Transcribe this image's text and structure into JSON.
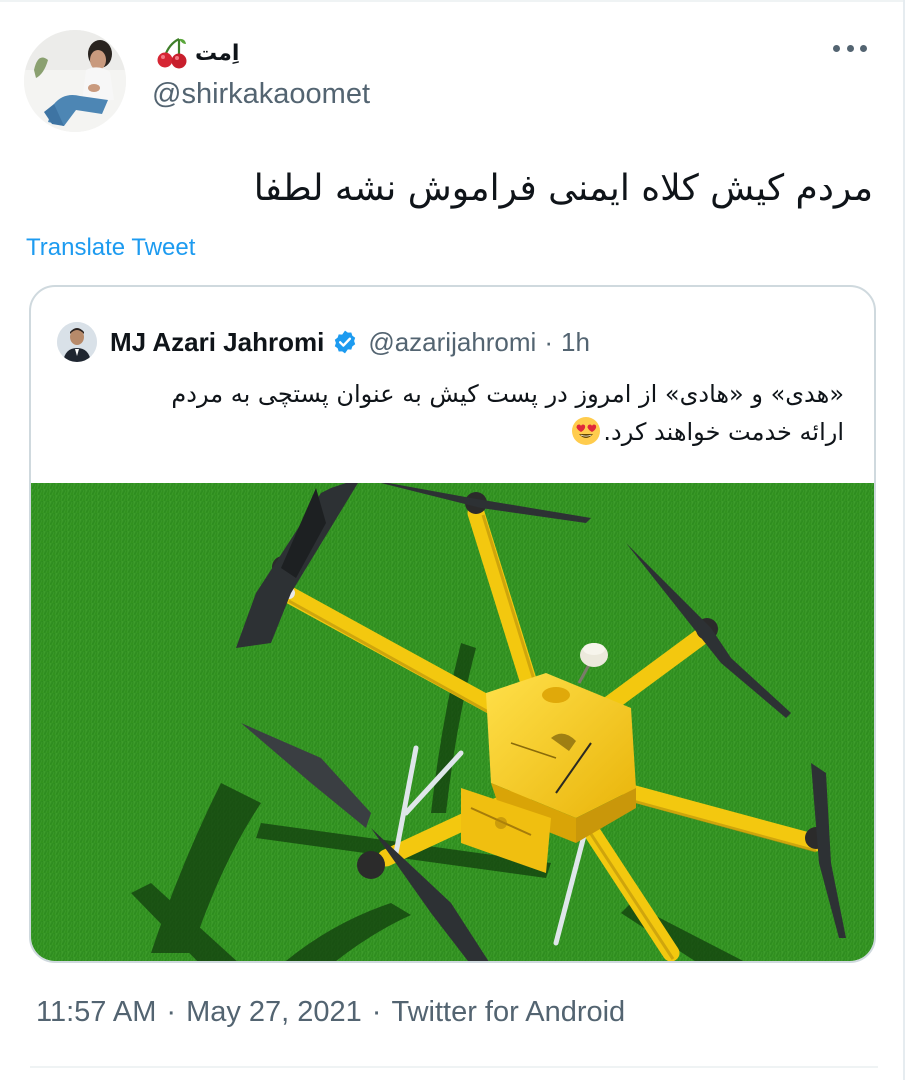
{
  "author": {
    "display_name": "اِمت",
    "handle": "@shirkakaoomet",
    "name_emoji": "cherries-icon"
  },
  "tweet": {
    "text": "مردم کیش کلاه ایمنی فراموش نشه لطفا",
    "translate_label": "Translate Tweet"
  },
  "quoted": {
    "name": "MJ Azari Jahromi",
    "verified": true,
    "handle": "@azarijahromi",
    "separator": "·",
    "time": "1h",
    "text_line1": "«هدی» و «هادی» از امروز در پست کیش به عنوان پستچی به مردم",
    "text_line2": "ارائه خدمت خواهند کرد.",
    "emoji": "smiling-face-with-heart-eyes-icon",
    "media": "yellow-delivery-drone-photo"
  },
  "meta": {
    "time": "11:57 AM",
    "separator": "·",
    "date": "May 27, 2021",
    "source": "Twitter for Android"
  },
  "colors": {
    "link": "#1d9bf0",
    "secondary_text": "#536471",
    "border": "#cfd9de",
    "grass": "#2f8f1f",
    "drone_yellow": "#f6cc12"
  }
}
